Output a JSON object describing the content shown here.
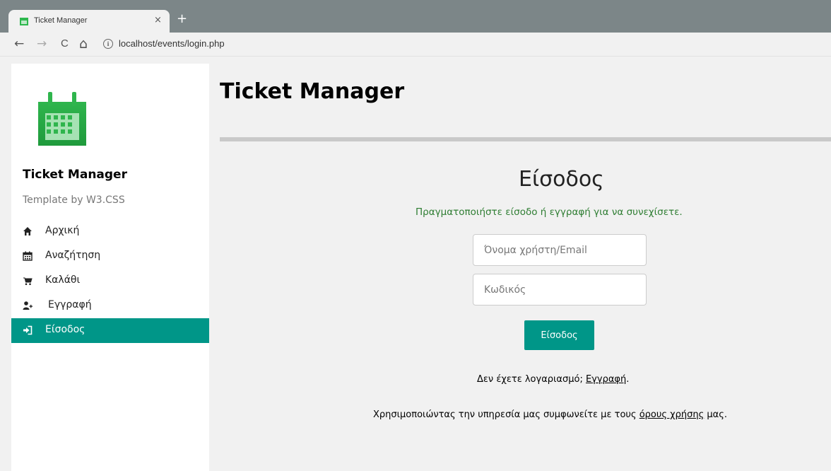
{
  "browser": {
    "tab_title": "Ticket Manager",
    "close_glyph": "×",
    "new_tab_glyph": "+",
    "url": "localhost/events/login.php",
    "back_glyph": "←",
    "forward_glyph": "→",
    "reload_glyph": "C",
    "home_glyph": "⌂",
    "info_glyph": "i"
  },
  "sidebar": {
    "title": "Ticket Manager",
    "subtitle": "Template by W3.CSS",
    "items": [
      {
        "label": "Αρχική",
        "icon": "home-icon"
      },
      {
        "label": "Αναζήτηση",
        "icon": "calendar-icon"
      },
      {
        "label": "Καλάθι",
        "icon": "cart-icon"
      },
      {
        "label": "Εγγραφή",
        "icon": "user-plus-icon"
      },
      {
        "label": "Είσοδος",
        "icon": "sign-in-icon",
        "active": true
      }
    ]
  },
  "main": {
    "title": "Ticket Manager",
    "login": {
      "heading": "Είσοδος",
      "message": "Πραγματοποιήστε είσοδο ή εγγραφή για να συνεχίσετε.",
      "username_placeholder": "Όνομα χρήστη/Email",
      "password_placeholder": "Κωδικός",
      "submit_label": "Είσοδος",
      "no_account_text": "Δεν έχετε λογαριασμό; ",
      "register_link": "Εγγραφή",
      "period": ".",
      "terms_prefix": "Χρησιμοποιώντας την υπηρεσία μας συμφωνείτε με τους ",
      "terms_link": "όρους χρήσης",
      "terms_suffix": " μας."
    }
  },
  "colors": {
    "accent": "#009688",
    "success_text": "#2e7d32",
    "logo_green": "#2eb84e"
  }
}
